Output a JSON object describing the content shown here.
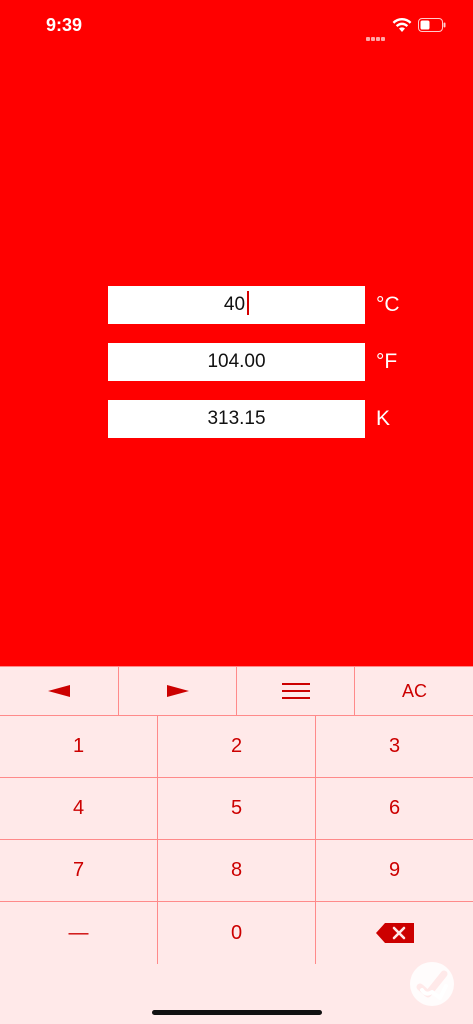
{
  "status_bar": {
    "time": "9:39"
  },
  "converter": {
    "rows": [
      {
        "value": "40",
        "unit": "°C"
      },
      {
        "value": "104.00",
        "unit": "°F"
      },
      {
        "value": "313.15",
        "unit": "K"
      }
    ]
  },
  "toolbar": {
    "clear_label": "AC"
  },
  "keypad": {
    "keys": [
      "1",
      "2",
      "3",
      "4",
      "5",
      "6",
      "7",
      "8",
      "9",
      "—",
      "0"
    ]
  },
  "colors": {
    "background_red": "#ff0000",
    "keypad_bg": "#ffe9e9",
    "accent": "#cc0000",
    "divider": "#ff8a8a"
  },
  "icons": {
    "wifi": "wifi-icon",
    "battery": "battery-icon",
    "left": "arrow-left-icon",
    "right": "arrow-right-icon",
    "menu": "menu-icon",
    "backspace": "backspace-icon",
    "corner": "checkmark-badge-icon"
  }
}
